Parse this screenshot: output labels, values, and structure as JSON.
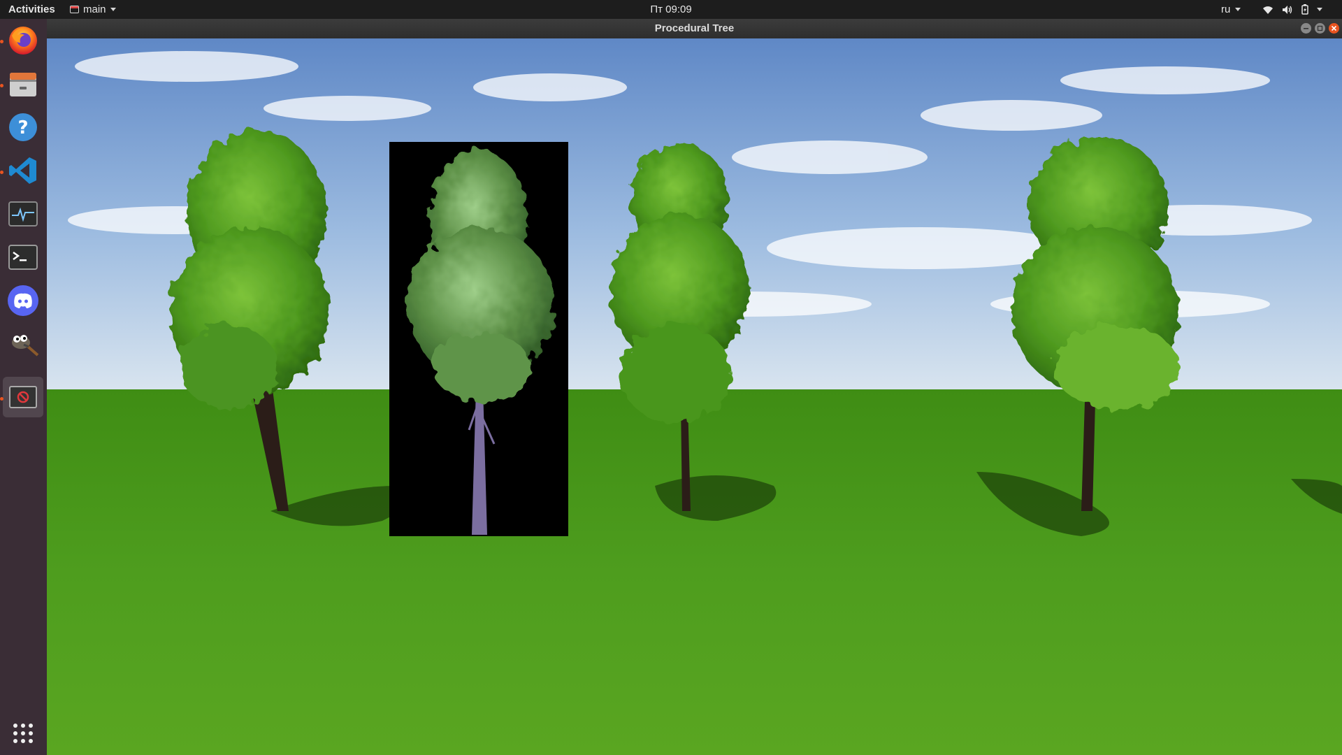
{
  "topbar": {
    "activities_label": "Activities",
    "app_menu_label": "main",
    "clock": "Пт 09:09",
    "language": "ru"
  },
  "dock": {
    "items": [
      {
        "name": "firefox",
        "running": true
      },
      {
        "name": "files",
        "running": true
      },
      {
        "name": "help",
        "running": false
      },
      {
        "name": "vscode",
        "running": true
      },
      {
        "name": "system-monitor",
        "running": false
      },
      {
        "name": "terminal",
        "running": false
      },
      {
        "name": "discord",
        "running": false
      },
      {
        "name": "gimp",
        "running": false
      },
      {
        "name": "procedural-tree-app",
        "running": true,
        "active": true
      }
    ],
    "show_apps_icon": "grid-icon"
  },
  "window": {
    "title": "Procedural Tree"
  },
  "scene": {
    "sky_color": "#8fb1dc",
    "grass_color": "#4e9a1e",
    "billboard_background": "#000000",
    "trees": [
      {
        "kind": "3d-tree"
      },
      {
        "kind": "billboard-texture"
      },
      {
        "kind": "3d-tree"
      },
      {
        "kind": "3d-tree"
      }
    ]
  },
  "colors": {
    "topbar": "#1d1d1d",
    "dock": "#3a2d36",
    "accent": "#e95420"
  }
}
